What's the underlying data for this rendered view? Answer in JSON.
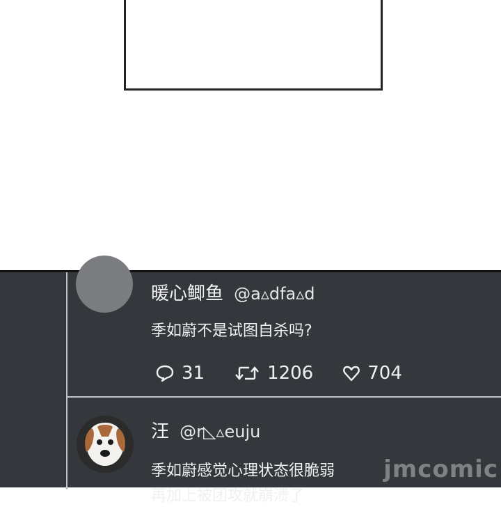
{
  "posts": [
    {
      "display_name": "暖心鲫鱼",
      "handle": "@a▵dfa▵d",
      "text": "季如蔚不是试图自杀吗?",
      "stats": {
        "comments": "31",
        "retweets": "1206",
        "likes": "704"
      },
      "avatar_icon": "gray-circle-avatar"
    },
    {
      "display_name": "汪",
      "handle": "@r◺▵euju",
      "text_line_1": "季如蔚感觉心理状态很脆弱",
      "text_line_2": "再加上被团攻就崩溃了",
      "avatar_icon": "dog-avatar"
    }
  ],
  "watermark": "jmcomic",
  "colors": {
    "feed_bg": "#34383d",
    "divider": "#bfc3c8",
    "text": "#f0f0f0"
  }
}
